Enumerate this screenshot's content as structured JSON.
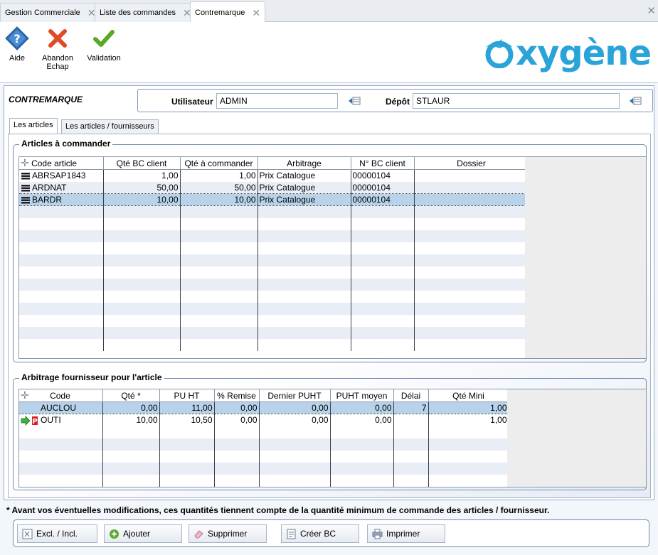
{
  "tabs": [
    {
      "label": "Gestion Commerciale",
      "active": false
    },
    {
      "label": "Liste des commandes",
      "active": false
    },
    {
      "label": "Contremarque",
      "active": true
    }
  ],
  "toolbar": {
    "help_label": "Aide",
    "abandon_label_line1": "Abandon",
    "abandon_label_line2": "Echap",
    "validate_label": "Validation"
  },
  "logo_text": "xygène",
  "header": {
    "title": "CONTREMARQUE",
    "user_label": "Utilisateur",
    "user_value": "ADMIN",
    "depot_label": "Dépôt",
    "depot_value": "STLAUR"
  },
  "subtabs": [
    {
      "label": "Les articles",
      "active": true
    },
    {
      "label": "Les articles / fournisseurs",
      "active": false
    }
  ],
  "articles": {
    "title": "Articles à commander",
    "columns": [
      "Code article",
      "Qté BC client",
      "Qté à commander",
      "Arbitrage",
      "N° BC client",
      "Dossier"
    ],
    "rows": [
      {
        "code": "ABRSAP1843",
        "qte_bc": "1,00",
        "qte_cmd": "1,00",
        "arbitrage": "Prix Catalogue",
        "bc": "00000104",
        "dossier": "",
        "selected": false
      },
      {
        "code": "ARDNAT",
        "qte_bc": "50,00",
        "qte_cmd": "50,00",
        "arbitrage": "Prix Catalogue",
        "bc": "00000104",
        "dossier": "",
        "selected": false
      },
      {
        "code": "BARDR",
        "qte_bc": "10,00",
        "qte_cmd": "10,00",
        "arbitrage": "Prix Catalogue",
        "bc": "00000104",
        "dossier": "",
        "selected": true
      }
    ]
  },
  "fournisseurs": {
    "title": "Arbitrage fournisseur pour l'article",
    "columns": [
      "Code",
      "Qté *",
      "PU HT",
      "% Remise",
      "Dernier PUHT",
      "PUHT moyen",
      "Délai",
      "Qté Mini"
    ],
    "rows": [
      {
        "code": "AUCLOU",
        "qte": "0,00",
        "puht": "11,00",
        "remise": "0,00",
        "dernier": "0,00",
        "moyen": "0,00",
        "delai": "7",
        "mini": "1,00",
        "selected": true,
        "flag": false
      },
      {
        "code": "OUTI",
        "qte": "10,00",
        "puht": "10,50",
        "remise": "0,00",
        "dernier": "0,00",
        "moyen": "0,00",
        "delai": "",
        "mini": "1,00",
        "selected": false,
        "flag": true
      }
    ]
  },
  "footnote": "* Avant vos éventuelles modifications, ces quantités tiennent compte de la quantité minimum de commande des articles / fournisseur.",
  "actions": {
    "excl": "Excl. / Incl.",
    "add": "Ajouter",
    "delete": "Supprimer",
    "create": "Créer BC",
    "print": "Imprimer"
  },
  "colors": {
    "accent": "#2aa4d8",
    "selection": "#b7d2ea",
    "band": "#e9eef6"
  }
}
